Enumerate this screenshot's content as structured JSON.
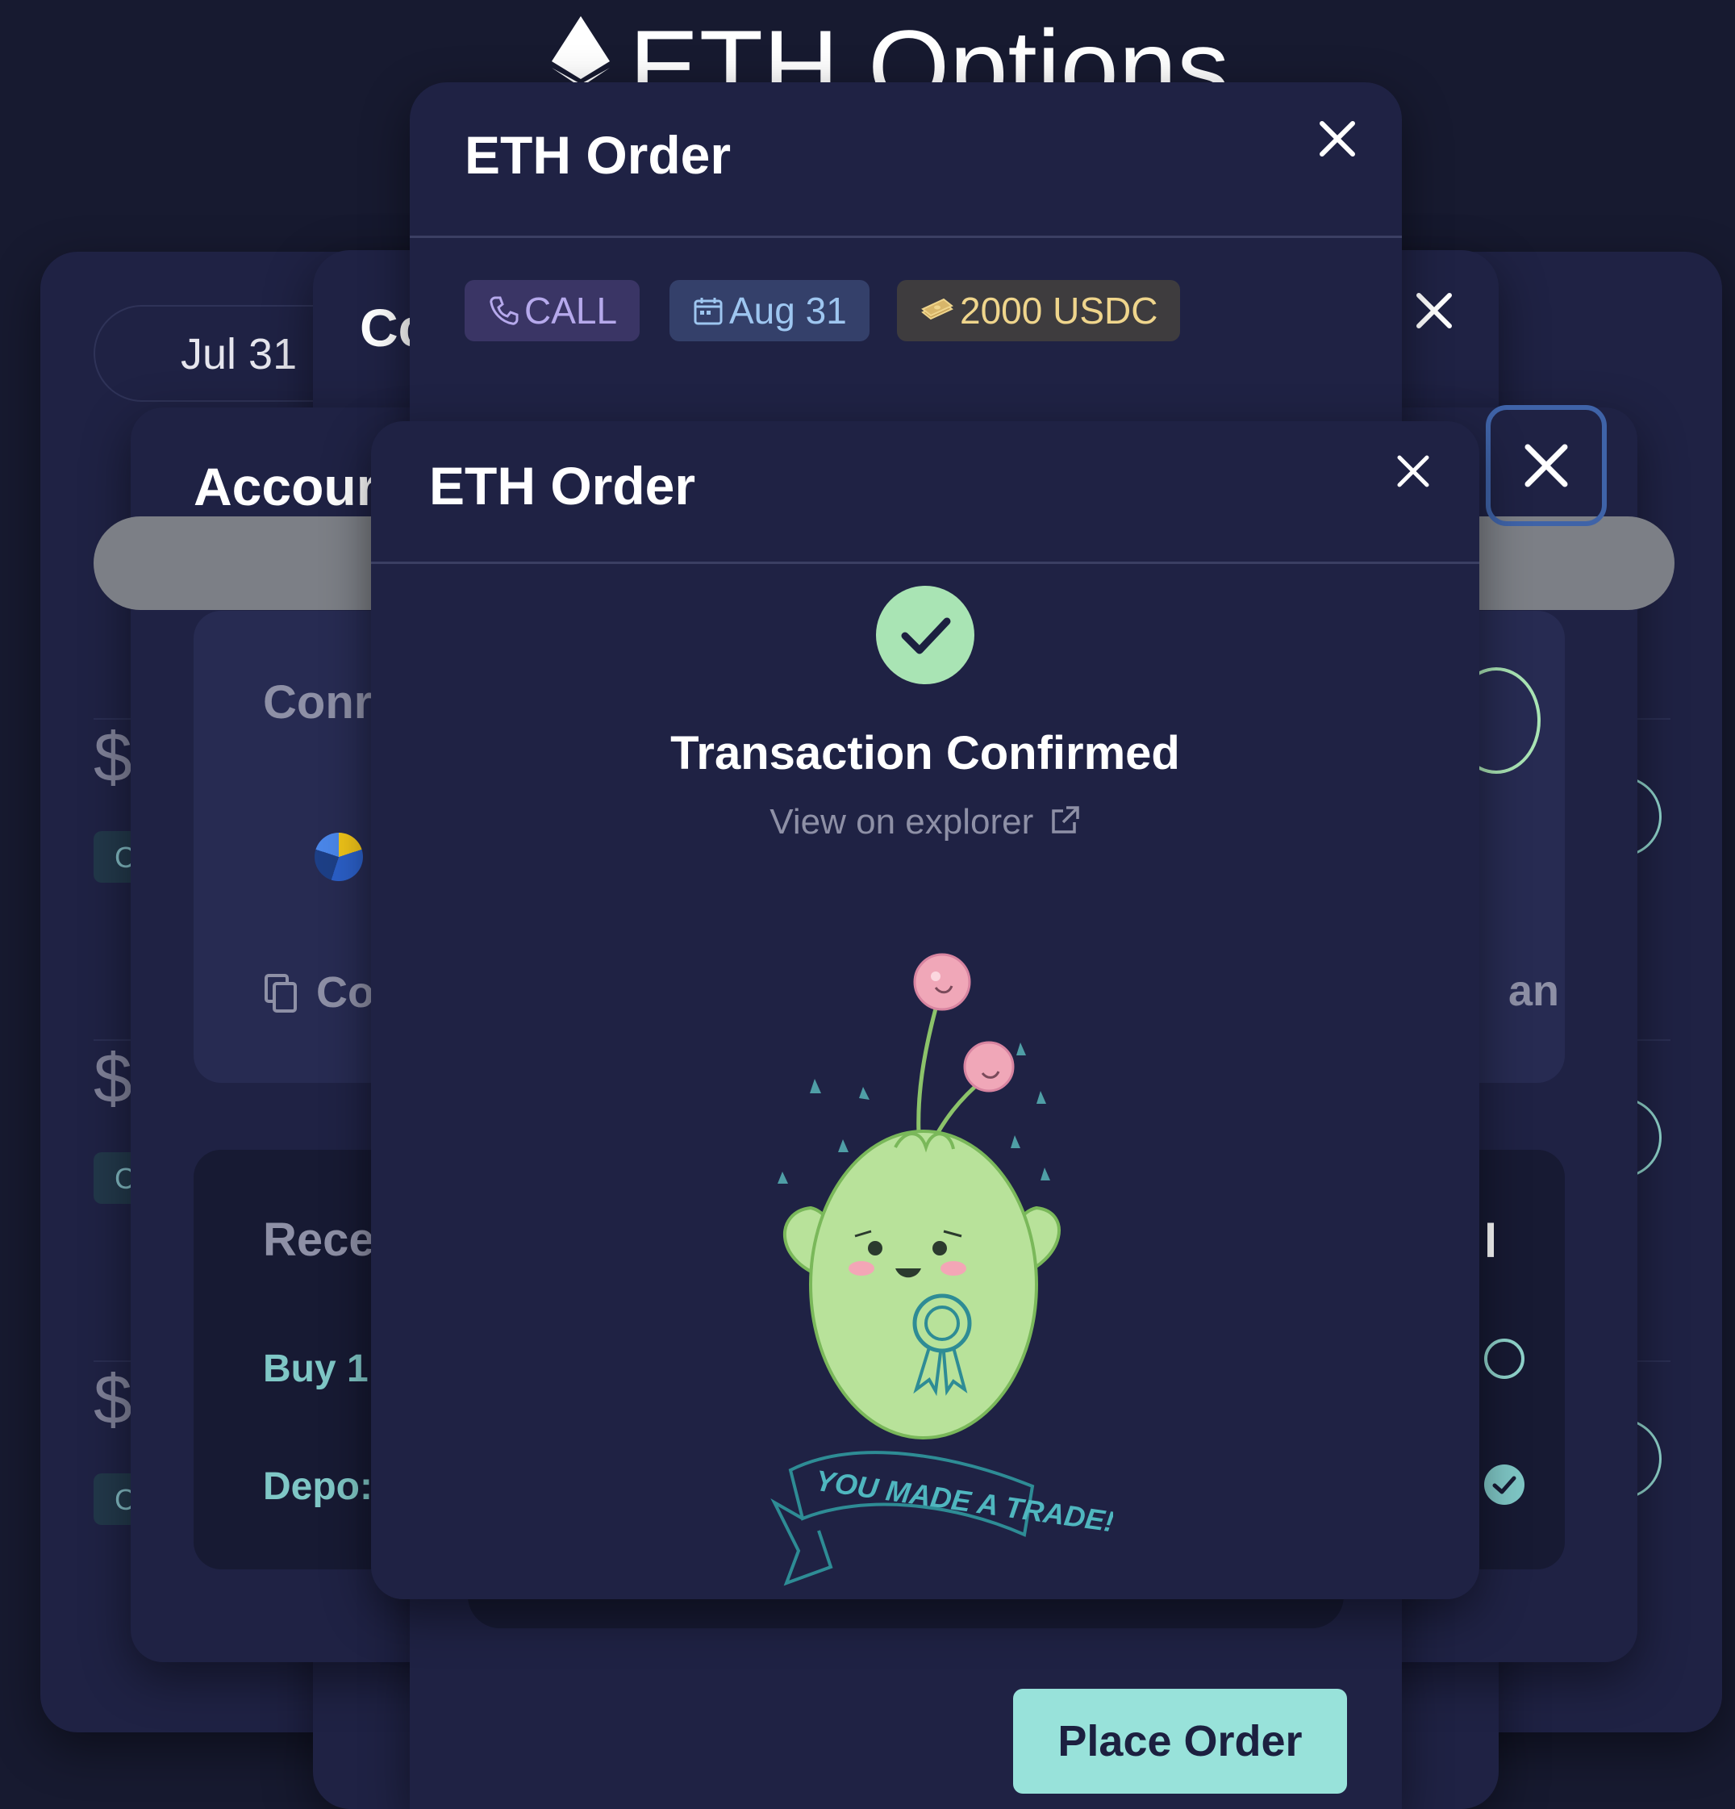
{
  "page": {
    "title": "ETH Options"
  },
  "back_panel": {
    "date_chip": "Jul 31",
    "partial_title": "Cc",
    "list_rows": [
      {
        "price_symbol": "$",
        "chip": "C"
      },
      {
        "price_symbol": "$",
        "chip": "C"
      },
      {
        "price_symbol": "$",
        "chip": "C"
      }
    ]
  },
  "account_panel": {
    "title": "Accour",
    "connected_label": "Conr",
    "copy_label": "Co",
    "right_partial_label": "an",
    "recent_label": "Rece",
    "recent_right_mark": "l",
    "recent_items": [
      "Buy 1",
      "Depo:"
    ]
  },
  "order_modal": {
    "title": "ETH Order",
    "tags": {
      "type": "CALL",
      "date": "Aug 31",
      "amount": "2000 USDC"
    },
    "place_order_label": "Place Order"
  },
  "confirm_modal": {
    "title": "ETH Order",
    "status_title": "Transaction Confirmed",
    "explorer_link": "View on explorer",
    "banner_text": "YOU MADE A TRADE!"
  },
  "colors": {
    "background": "#171a30",
    "panel": "#1f2244",
    "accent_teal": "#98e2da",
    "success_green": "#a9e4b4",
    "call_tag_bg": "#3a3565",
    "date_tag_bg": "#34406a",
    "amount_tag_bg": "#3e3c3e"
  }
}
